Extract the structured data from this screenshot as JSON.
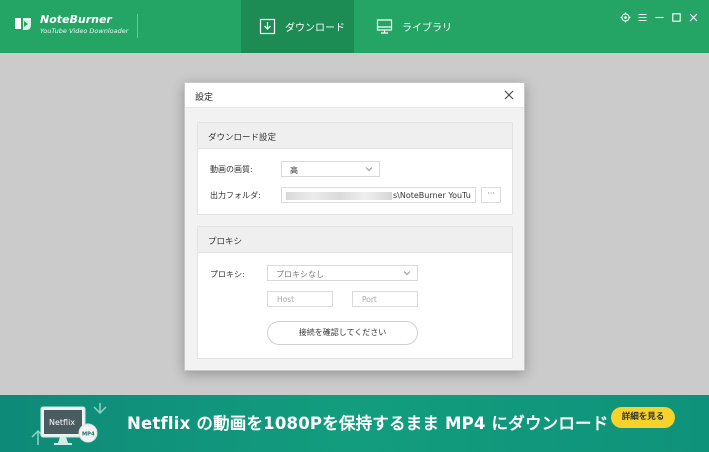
{
  "app": {
    "brand_name": "NoteBurner",
    "brand_sub": "YouTube Video Downloader"
  },
  "tabs": [
    {
      "label": "ダウンロード",
      "icon": "download-icon",
      "active": true
    },
    {
      "label": "ライブラリ",
      "icon": "monitor-icon",
      "active": false
    }
  ],
  "window_controls": [
    "settings-icon",
    "menu-icon",
    "minimize-icon",
    "maximize-icon",
    "close-icon"
  ],
  "dialog": {
    "title": "設定",
    "download_section": {
      "title": "ダウンロード設定",
      "quality_label": "動画の画質:",
      "quality_value": "高",
      "output_label": "出力フォルダ:",
      "output_value": "s\\NoteBurner YouTu",
      "browse_label": "···"
    },
    "proxy_section": {
      "title": "プロキシ",
      "proxy_label": "プロキシ:",
      "proxy_value": "プロキシなし",
      "host_placeholder": "Host",
      "port_placeholder": "Port",
      "check_button": "接続を確認してください"
    }
  },
  "banner": {
    "art_label": "Netflix",
    "art_badge": "MP4",
    "text": "Netflix の動画を1080Pを保持するまま MP4 にダウンロード",
    "button": "詳細を見る"
  },
  "colors": {
    "header": "#24a565",
    "active_tab": "#1c8c54",
    "banner": "#139d7e",
    "banner_button": "#f6d22a"
  }
}
